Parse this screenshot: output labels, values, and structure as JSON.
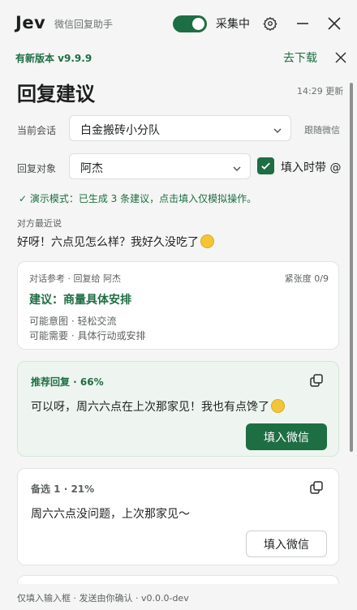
{
  "titlebar": {
    "logo": "Jev",
    "app_name": "微信回复助手",
    "collect_label": "采集中",
    "collect_on": true,
    "icons": [
      "gear-icon",
      "minimize-icon",
      "close-icon"
    ]
  },
  "update": {
    "text": "有新版本 v9.9.9",
    "download_label": "去下载"
  },
  "main": {
    "title": "回复建议",
    "updated": "14:29 更新",
    "session_label": "当前会话",
    "session_value": "白金搬砖小分队",
    "follow_label": "跟随微信",
    "target_label": "回复对象",
    "target_value": "阿杰",
    "fill_with_at": "填入时带 @",
    "fill_with_at_checked": true,
    "demo_note": "✓  演示模式：已生成 3 条建议，点击填入仅模拟操作。",
    "other_label": "对方最近说",
    "other_message": "好呀！六点见怎么样？我好久没吃了"
  },
  "reference": {
    "header": "对话参考 · 回复给 阿杰",
    "tension": "紧张度 0/9",
    "suggestion": "建议：商量具体安排",
    "intent": "可能意图 · 轻松交流",
    "need": "可能需要 · 具体行动或安排"
  },
  "suggestions": [
    {
      "tag": "推荐回复 · 66%",
      "text": "可以呀，周六六点在上次那家见！我也有点馋了",
      "button": "填入微信",
      "recommended": true
    },
    {
      "tag": "备选 1 · 21%",
      "text": "周六六点没问题，上次那家见～",
      "button": "填入微信",
      "recommended": false
    }
  ],
  "footer": {
    "text": "仅填入输入框 · 发送由你确认 · v0.0.0-dev"
  },
  "colors": {
    "accent": "#1e6e43",
    "background": "#f4f5f4",
    "recommended_bg": "#eef5f0"
  }
}
